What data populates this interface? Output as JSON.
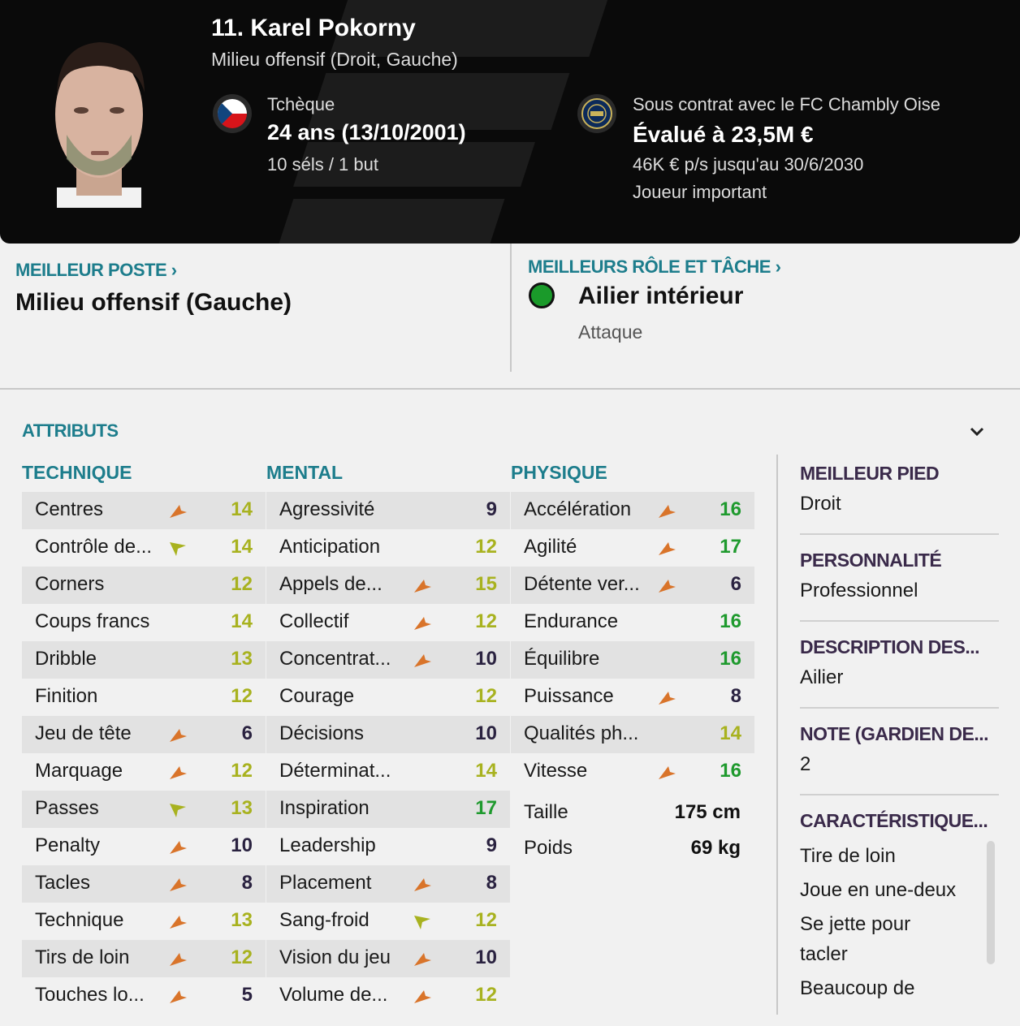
{
  "header": {
    "player_name": "11. Karel Pokorny",
    "position": "Milieu offensif (Droit, Gauche)",
    "nationality": "Tchèque",
    "age": "24 ans (13/10/2001)",
    "caps": "10 séls / 1 but",
    "contract": "Sous contrat avec le FC Chambly Oise",
    "value": "Évalué à 23,5M €",
    "wage": "46K € p/s jusqu'au 30/6/2030",
    "squad_status": "Joueur important"
  },
  "best_position": {
    "label": "MEILLEUR POSTE",
    "value": "Milieu offensif (Gauche)"
  },
  "best_role": {
    "label": "MEILLEURS RÔLE ET TÂCHE",
    "role": "Ailier intérieur",
    "duty": "Attaque"
  },
  "attributes": {
    "title": "ATTRIBUTS",
    "technique": {
      "title": "TECHNIQUE",
      "rows": [
        {
          "label": "Centres",
          "value": "14",
          "color": "yellow",
          "arrow": "down"
        },
        {
          "label": "Contrôle de...",
          "value": "14",
          "color": "yellow",
          "arrow": "up"
        },
        {
          "label": "Corners",
          "value": "12",
          "color": "yellow",
          "arrow": ""
        },
        {
          "label": "Coups francs",
          "value": "14",
          "color": "yellow",
          "arrow": ""
        },
        {
          "label": "Dribble",
          "value": "13",
          "color": "yellow",
          "arrow": ""
        },
        {
          "label": "Finition",
          "value": "12",
          "color": "yellow",
          "arrow": ""
        },
        {
          "label": "Jeu de tête",
          "value": "6",
          "color": "dark",
          "arrow": "down"
        },
        {
          "label": "Marquage",
          "value": "12",
          "color": "yellow",
          "arrow": "down"
        },
        {
          "label": "Passes",
          "value": "13",
          "color": "yellow",
          "arrow": "up"
        },
        {
          "label": "Penalty",
          "value": "10",
          "color": "dark",
          "arrow": "down"
        },
        {
          "label": "Tacles",
          "value": "8",
          "color": "dark",
          "arrow": "down"
        },
        {
          "label": "Technique",
          "value": "13",
          "color": "yellow",
          "arrow": "down"
        },
        {
          "label": "Tirs de loin",
          "value": "12",
          "color": "yellow",
          "arrow": "down"
        },
        {
          "label": "Touches lo...",
          "value": "5",
          "color": "dark",
          "arrow": "down"
        }
      ]
    },
    "mental": {
      "title": "MENTAL",
      "rows": [
        {
          "label": "Agressivité",
          "value": "9",
          "color": "dark",
          "arrow": ""
        },
        {
          "label": "Anticipation",
          "value": "12",
          "color": "yellow",
          "arrow": ""
        },
        {
          "label": "Appels de...",
          "value": "15",
          "color": "yellow",
          "arrow": "down"
        },
        {
          "label": "Collectif",
          "value": "12",
          "color": "yellow",
          "arrow": "down"
        },
        {
          "label": "Concentrat...",
          "value": "10",
          "color": "dark",
          "arrow": "down"
        },
        {
          "label": "Courage",
          "value": "12",
          "color": "yellow",
          "arrow": ""
        },
        {
          "label": "Décisions",
          "value": "10",
          "color": "dark",
          "arrow": ""
        },
        {
          "label": "Déterminat...",
          "value": "14",
          "color": "yellow",
          "arrow": ""
        },
        {
          "label": "Inspiration",
          "value": "17",
          "color": "green",
          "arrow": ""
        },
        {
          "label": "Leadership",
          "value": "9",
          "color": "dark",
          "arrow": ""
        },
        {
          "label": "Placement",
          "value": "8",
          "color": "dark",
          "arrow": "down"
        },
        {
          "label": "Sang-froid",
          "value": "12",
          "color": "yellow",
          "arrow": "up"
        },
        {
          "label": "Vision du jeu",
          "value": "10",
          "color": "dark",
          "arrow": "down"
        },
        {
          "label": "Volume de...",
          "value": "12",
          "color": "yellow",
          "arrow": "down"
        }
      ]
    },
    "physique": {
      "title": "PHYSIQUE",
      "rows": [
        {
          "label": "Accélération",
          "value": "16",
          "color": "green",
          "arrow": "down"
        },
        {
          "label": "Agilité",
          "value": "17",
          "color": "green",
          "arrow": "down"
        },
        {
          "label": "Détente ver...",
          "value": "6",
          "color": "dark",
          "arrow": "down"
        },
        {
          "label": "Endurance",
          "value": "16",
          "color": "green",
          "arrow": ""
        },
        {
          "label": "Équilibre",
          "value": "16",
          "color": "green",
          "arrow": ""
        },
        {
          "label": "Puissance",
          "value": "8",
          "color": "dark",
          "arrow": "down"
        },
        {
          "label": "Qualités ph...",
          "value": "14",
          "color": "yellow",
          "arrow": ""
        },
        {
          "label": "Vitesse",
          "value": "16",
          "color": "green",
          "arrow": "down"
        }
      ],
      "height_label": "Taille",
      "height_value": "175 cm",
      "weight_label": "Poids",
      "weight_value": "69 kg"
    }
  },
  "colors": {
    "yellow": "#a8b21f",
    "green": "#1f9a2e",
    "dark": "#2a2240",
    "arrow_down": "#d9742a",
    "arrow_up": "#a8b21f",
    "teal": "#1d7d8c"
  },
  "sidebar": {
    "foot_title": "MEILLEUR PIED",
    "foot_value": "Droit",
    "personality_title": "PERSONNALITÉ",
    "personality_value": "Professionnel",
    "description_title": "DESCRIPTION DES...",
    "description_value": "Ailier",
    "gk_title": "NOTE (GARDIEN DE...",
    "gk_value": "2",
    "traits_title": "CARACTÉRISTIQUE...",
    "traits": [
      "Tire de loin",
      "Joue en une-deux",
      "Se jette pour",
      "tacler",
      "Beaucoup de"
    ]
  }
}
